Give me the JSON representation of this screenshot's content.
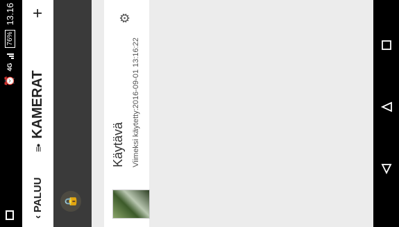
{
  "status": {
    "network": "4G",
    "battery": "76%",
    "time": "13.16"
  },
  "header": {
    "back_label": "PALUU",
    "title": "KAMERAT",
    "add_symbol": "+"
  },
  "camera": {
    "name": "Käytävä",
    "last_used": "Viimeksi käytetty:2016-09-01 13:16:22"
  },
  "icons": {
    "back": "chevron-left-icon",
    "title": "list-icon",
    "add": "plus-icon",
    "lock": "lock-icon",
    "settings": "gear-icon"
  },
  "colors": {
    "accent": "#e8a21a",
    "strip": "#3a3a3a",
    "background": "#ececec"
  }
}
